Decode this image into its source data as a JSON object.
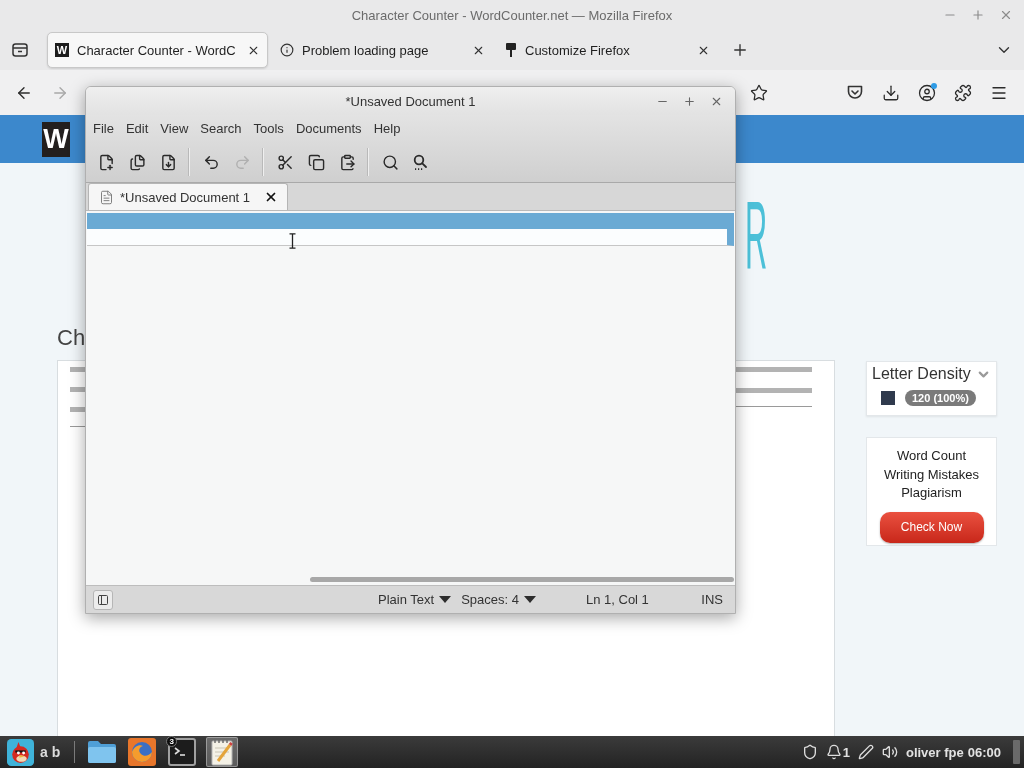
{
  "firefox": {
    "title": "Character Counter - WordCounter.net — Mozilla Firefox",
    "tabs": [
      {
        "title": "Character Counter - WordC",
        "kind": "letter",
        "favicon_text": "W",
        "selected": true
      },
      {
        "title": "Problem loading page",
        "kind": "info",
        "selected": false
      },
      {
        "title": "Customize Firefox",
        "kind": "pin",
        "selected": false
      }
    ],
    "nav_buttons": [
      {
        "kind": "back",
        "disabled": false
      },
      {
        "kind": "forward",
        "disabled": true
      }
    ],
    "toolbar_buttons": [
      {
        "kind": "pocket"
      },
      {
        "kind": "downloads"
      },
      {
        "kind": "account",
        "notification": true
      },
      {
        "kind": "extensions"
      },
      {
        "kind": "menu"
      }
    ]
  },
  "page": {
    "logo_box": "W",
    "hero_letter": "R",
    "heading": "Ch",
    "letter_density": {
      "title": "Letter Density",
      "rows": [
        {
          "color": "#2f3a4d",
          "count": "120 (100%)"
        }
      ]
    },
    "promo": {
      "lines": [
        "Word Count",
        "Writing Mistakes",
        "Plagiarism"
      ],
      "button": "Check Now"
    }
  },
  "gedit": {
    "title": "*Unsaved Document 1",
    "menu": [
      "File",
      "Edit",
      "View",
      "Search",
      "Tools",
      "Documents",
      "Help"
    ],
    "toolbar": [
      [
        {
          "kind": "new",
          "disabled": false
        },
        {
          "kind": "open",
          "disabled": false
        },
        {
          "kind": "save",
          "disabled": false
        }
      ],
      [
        {
          "kind": "undo",
          "disabled": false
        },
        {
          "kind": "redo",
          "disabled": true
        }
      ],
      [
        {
          "kind": "cut",
          "disabled": false
        },
        {
          "kind": "copy",
          "disabled": false
        },
        {
          "kind": "paste",
          "disabled": false
        }
      ],
      [
        {
          "kind": "find",
          "disabled": false
        },
        {
          "kind": "replace",
          "disabled": false
        }
      ]
    ],
    "tabs": [
      {
        "title": "*Unsaved Document 1",
        "selected": true
      }
    ],
    "status_bar": {
      "language": "Plain Text",
      "indent": "Spaces: 4",
      "position": "Ln 1, Col 1",
      "mode": "INS"
    }
  },
  "taskbar": {
    "layout": "a b",
    "windows": [
      {
        "kind": "files",
        "selected": false
      },
      {
        "kind": "browser",
        "selected": false
      },
      {
        "kind": "terminal",
        "selected": false,
        "badge": "3"
      },
      {
        "kind": "editor",
        "selected": true
      }
    ],
    "tray": [
      {
        "kind": "shield"
      },
      {
        "kind": "notifications",
        "count": "1"
      },
      {
        "kind": "pen"
      },
      {
        "kind": "volume"
      }
    ],
    "user": "oliver fpe",
    "clock": "06:00"
  }
}
